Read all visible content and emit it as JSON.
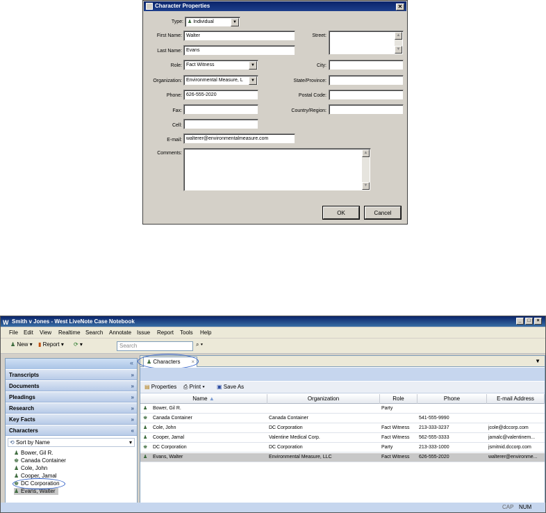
{
  "dialog": {
    "title": "Character Properties",
    "close": "✕",
    "type_label": "Type:",
    "type_value": "Individual",
    "first_name_label": "First Name:",
    "first_name": "Walter",
    "last_name_label": "Last Name:",
    "last_name": "Evans",
    "role_label": "Role:",
    "role": "Fact Witness",
    "org_label": "Organization:",
    "org": "Environmental Measure, L",
    "phone_label": "Phone:",
    "phone": "626-555-2020",
    "fax_label": "Fax:",
    "fax": "",
    "cell_label": "Cell:",
    "cell": "",
    "email_label": "E-mail:",
    "email": "walterer@environmentalmeasure.com",
    "comments_label": "Comments:",
    "comments": "",
    "street_label": "Street:",
    "city_label": "City:",
    "state_label": "State/Province:",
    "postal_label": "Postal Code:",
    "country_label": "Country/Region:",
    "ok": "OK",
    "cancel": "Cancel"
  },
  "app": {
    "title": "Smith v Jones - West LiveNote Case Notebook",
    "win_min": "_",
    "win_max": "□",
    "win_close": "×",
    "menu": [
      "File",
      "Edit",
      "View",
      "Realtime",
      "Search",
      "Annotate",
      "Issue",
      "Report",
      "Tools",
      "Help"
    ],
    "toolbar": {
      "new": "New",
      "report": "Report",
      "search_placeholder": "Search"
    },
    "collapse": "«",
    "sections": [
      "Transcripts",
      "Documents",
      "Pleadings",
      "Research",
      "Key Facts",
      "Characters"
    ],
    "sort_label": "Sort by Name",
    "tree": [
      "Bower, Gil R.",
      "Canada Container",
      "Cole, John",
      "Cooper, Jamal",
      "DC Corporation",
      "Evans, Walter"
    ],
    "tab": "Characters",
    "tab_close": "×",
    "grid_toolbar": {
      "properties": "Properties",
      "print": "Print",
      "save_as": "Save As"
    },
    "columns": [
      "Name",
      "Organization",
      "Role",
      "Phone",
      "E-mail Address"
    ],
    "rows": [
      [
        "Bower, Gil R.",
        "",
        "Party",
        "",
        ""
      ],
      [
        "Canada Container",
        "Canada Container",
        "",
        "541-555-9990",
        ""
      ],
      [
        "Cole, John",
        "DC Corporation",
        "Fact Witness",
        "213-333-3237",
        "jcole@dccorp.com"
      ],
      [
        "Cooper, Jamal",
        "Valentine Medical Corp.",
        "Fact Witness",
        "562-555-3333",
        "jamalc@valentinem..."
      ],
      [
        "DC Corporation",
        "DC Corporation",
        "Party",
        "213-333-1000",
        "jsmitnid.dccorp.com"
      ],
      [
        "Evans, Walter",
        "Environmental Measure, LLC",
        "Fact Witness",
        "626-555-2020",
        "walterer@environme..."
      ]
    ],
    "status": {
      "cap": "CAP",
      "num": "NUM"
    }
  }
}
